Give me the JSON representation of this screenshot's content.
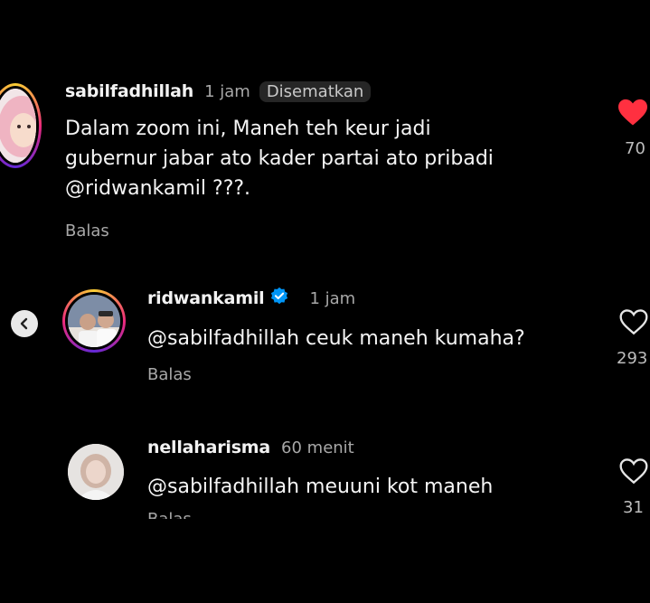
{
  "comments": [
    {
      "username": "sabilfadhillah",
      "time": "1 jam",
      "pinned_label": "Disematkan",
      "text_lines": [
        "Dalam zoom ini, Maneh teh keur jadi",
        "gubernur jabar ato kader partai ato pribadi",
        "@ridwankamil ???."
      ],
      "reply_label": "Balas",
      "likes": "70",
      "liked": true,
      "like_color": "#ff3040"
    },
    {
      "username": "ridwankamil",
      "time": "1 jam",
      "verified": true,
      "verified_color": "#0095f6",
      "text_lines": [
        "@sabilfadhillah ceuk maneh kumaha?"
      ],
      "reply_label": "Balas",
      "likes": "293",
      "liked": false
    },
    {
      "username": "nellaharisma",
      "time": "60 menit",
      "text_lines": [
        "@sabilfadhillah meuuni kot maneh"
      ],
      "reply_label": "Balas",
      "likes": "31",
      "liked": false
    }
  ]
}
